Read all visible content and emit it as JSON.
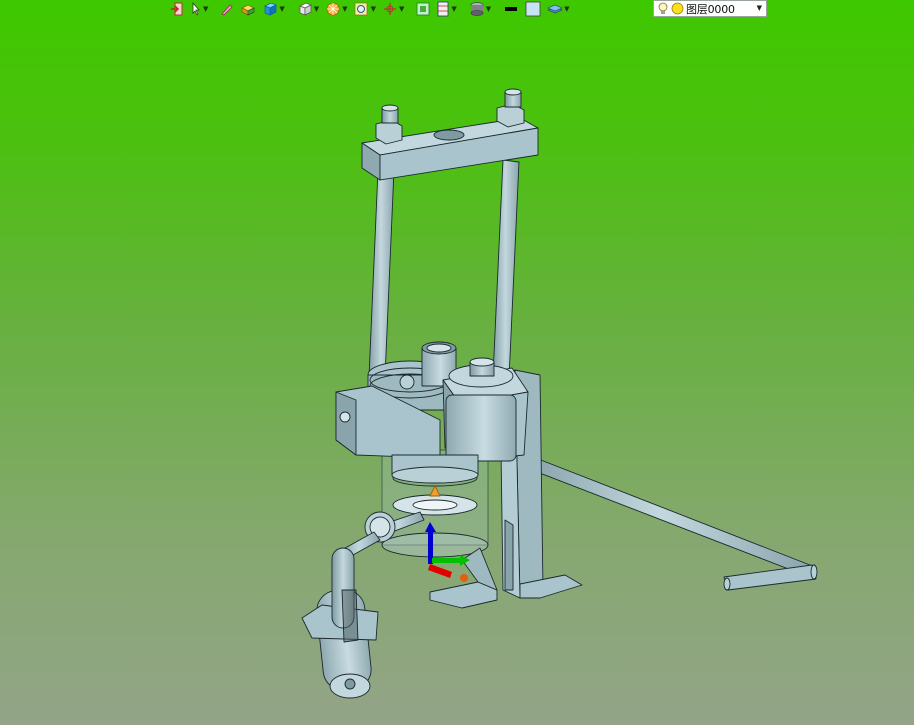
{
  "toolbar": {
    "items": [
      {
        "icon": "exit-icon"
      },
      {
        "icon": "pointer-icon"
      },
      {
        "icon": "sketch-pen-icon"
      },
      {
        "icon": "solid-box-icon"
      },
      {
        "icon": "shaded-cube-icon"
      },
      {
        "icon": "wireframe-cube-icon"
      },
      {
        "icon": "render-style-icon"
      },
      {
        "icon": "zoom-fit-icon"
      },
      {
        "icon": "pan-orbit-icon"
      },
      {
        "icon": "fit-view-icon"
      },
      {
        "icon": "view-direction-icon"
      },
      {
        "icon": "cylinder-icon"
      },
      {
        "icon": "line-style-icon"
      },
      {
        "icon": "color-swatch-icon"
      },
      {
        "icon": "layer-stack-icon"
      }
    ],
    "layer_selector": {
      "value": "图层0000",
      "bulb_icon": "lightbulb-icon",
      "status_icon": "yellow-sun-icon"
    }
  },
  "colors": {
    "background_top": "#3ec800",
    "background_bottom": "#93a488",
    "part_fill": "#a9c4cc",
    "part_edge": "#1a2a2e",
    "axis_x": "#e00000",
    "axis_y": "#00c000",
    "axis_z": "#0000d0"
  }
}
